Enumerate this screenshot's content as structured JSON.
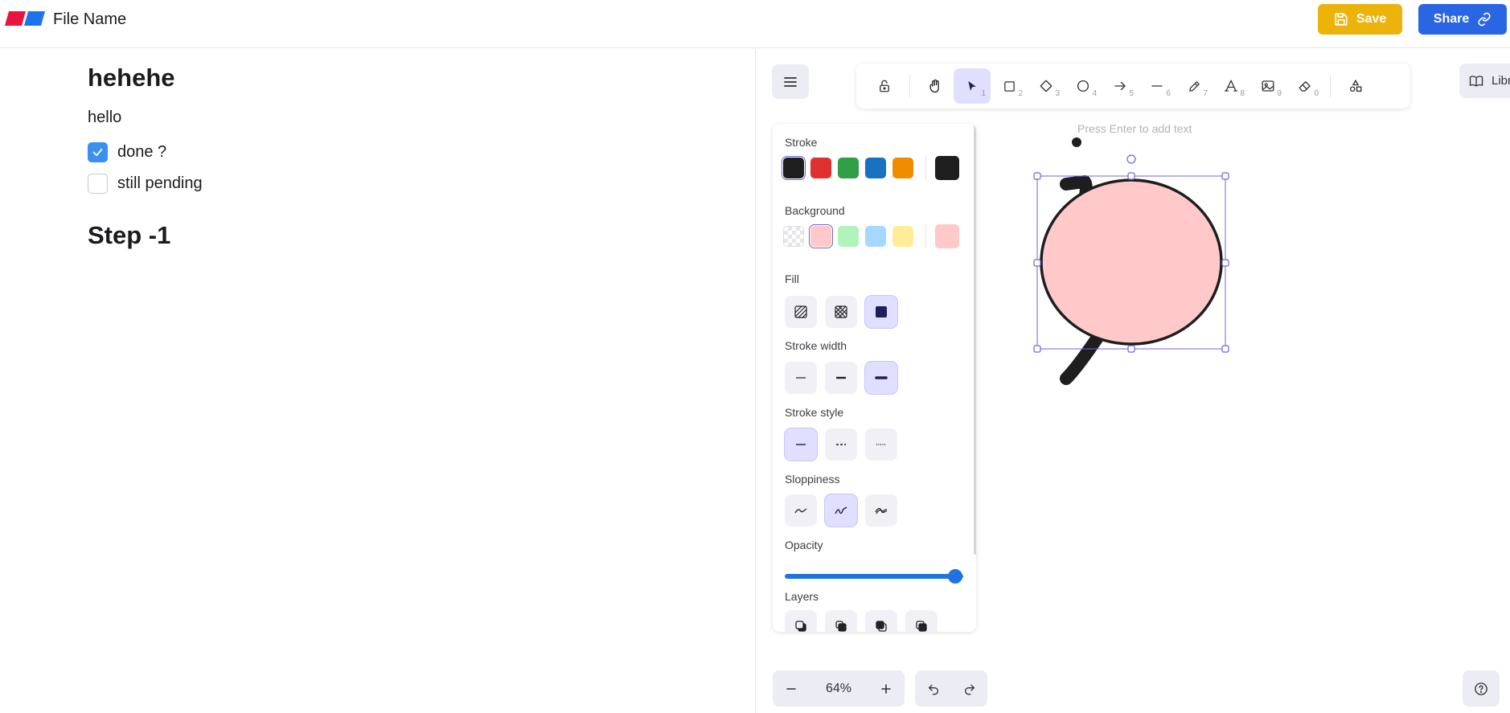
{
  "header": {
    "file_name": "File Name",
    "save_label": "Save",
    "share_label": "Share",
    "logo_colors": [
      "#e8133f",
      "#1d73e9"
    ]
  },
  "editor": {
    "heading1": "hehehe",
    "paragraph": "hello",
    "todos": [
      {
        "label": "done ?",
        "checked": true
      },
      {
        "label": "still pending",
        "checked": false
      }
    ],
    "heading2": "Step -1"
  },
  "toolbar": {
    "tools": [
      {
        "name": "lock",
        "key": ""
      },
      {
        "name": "hand",
        "key": ""
      },
      {
        "name": "selection",
        "key": "1",
        "selected": true
      },
      {
        "name": "rectangle",
        "key": "2"
      },
      {
        "name": "diamond",
        "key": "3"
      },
      {
        "name": "ellipse",
        "key": "4"
      },
      {
        "name": "arrow",
        "key": "5"
      },
      {
        "name": "line",
        "key": "6"
      },
      {
        "name": "draw",
        "key": "7"
      },
      {
        "name": "text",
        "key": "8"
      },
      {
        "name": "image",
        "key": "9"
      },
      {
        "name": "eraser",
        "key": "0"
      },
      {
        "name": "extra-tools",
        "key": ""
      }
    ],
    "library_label": "Libr"
  },
  "canvas": {
    "hint": "Press Enter to add text"
  },
  "properties": {
    "stroke_label": "Stroke",
    "stroke_colors": [
      "#1e1e1e",
      "#e03131",
      "#2f9e44",
      "#1971c2",
      "#f08c00"
    ],
    "stroke_current": "#1e1e1e",
    "background_label": "Background",
    "background_colors": [
      "transparent",
      "#ffc9c9",
      "#b2f2bb",
      "#a5d8ff",
      "#ffec99"
    ],
    "background_current": "#ffc9c9",
    "fill_label": "Fill",
    "fill_selected": "solid",
    "stroke_width_label": "Stroke width",
    "stroke_width_selected": "extra-bold",
    "stroke_style_label": "Stroke style",
    "stroke_style_selected": "solid",
    "sloppiness_label": "Sloppiness",
    "sloppiness_selected": "artist",
    "opacity_label": "Opacity",
    "opacity_value": 100,
    "layers_label": "Layers"
  },
  "footer": {
    "zoom_level": "64%"
  },
  "colors": {
    "accent": "#6965db",
    "selected_bg": "#e0dfff",
    "save_bg": "#ecb30a",
    "share_bg": "#2a66e4"
  }
}
